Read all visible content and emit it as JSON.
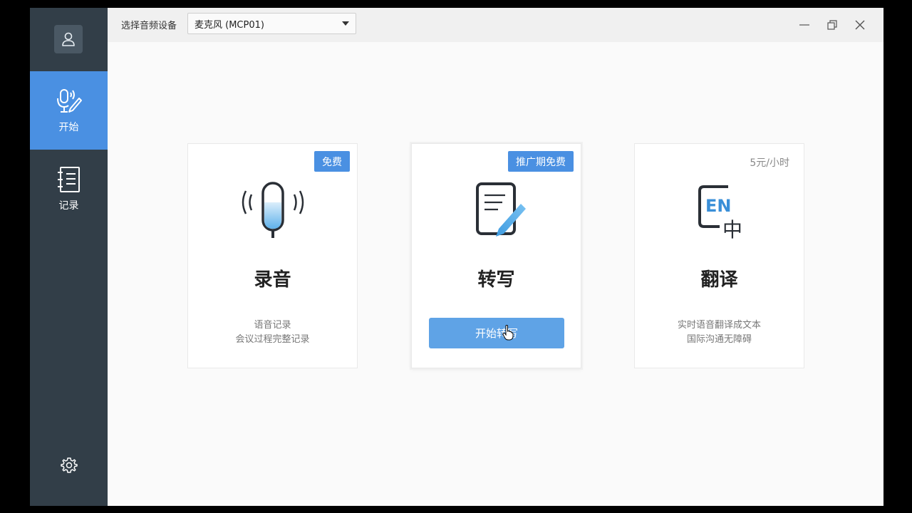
{
  "sidebar": {
    "items": [
      {
        "label": "开始",
        "icon": "mic-pen-icon",
        "active": true
      },
      {
        "label": "记录",
        "icon": "notebook-icon",
        "active": false
      }
    ]
  },
  "topbar": {
    "device_label": "选择音频设备",
    "device_selected": "麦克风 (MCP01)"
  },
  "cards": [
    {
      "title": "录音",
      "badge": "免费",
      "desc_line1": "语音记录",
      "desc_line2": "会议过程完整记录",
      "icon": "microphone-icon"
    },
    {
      "title": "转写",
      "badge": "推广期免费",
      "button_label": "开始转写",
      "icon": "document-pen-icon"
    },
    {
      "title": "翻译",
      "price": "5元/小时",
      "desc_line1": "实时语音翻译成文本",
      "desc_line2": "国际沟通无障碍",
      "icon": "en-zh-translate-icon",
      "icon_text_en": "EN",
      "icon_text_zh": "中"
    }
  ],
  "colors": {
    "sidebar_bg": "#323e48",
    "accent": "#4a90e2",
    "button": "#5fa3e6"
  }
}
